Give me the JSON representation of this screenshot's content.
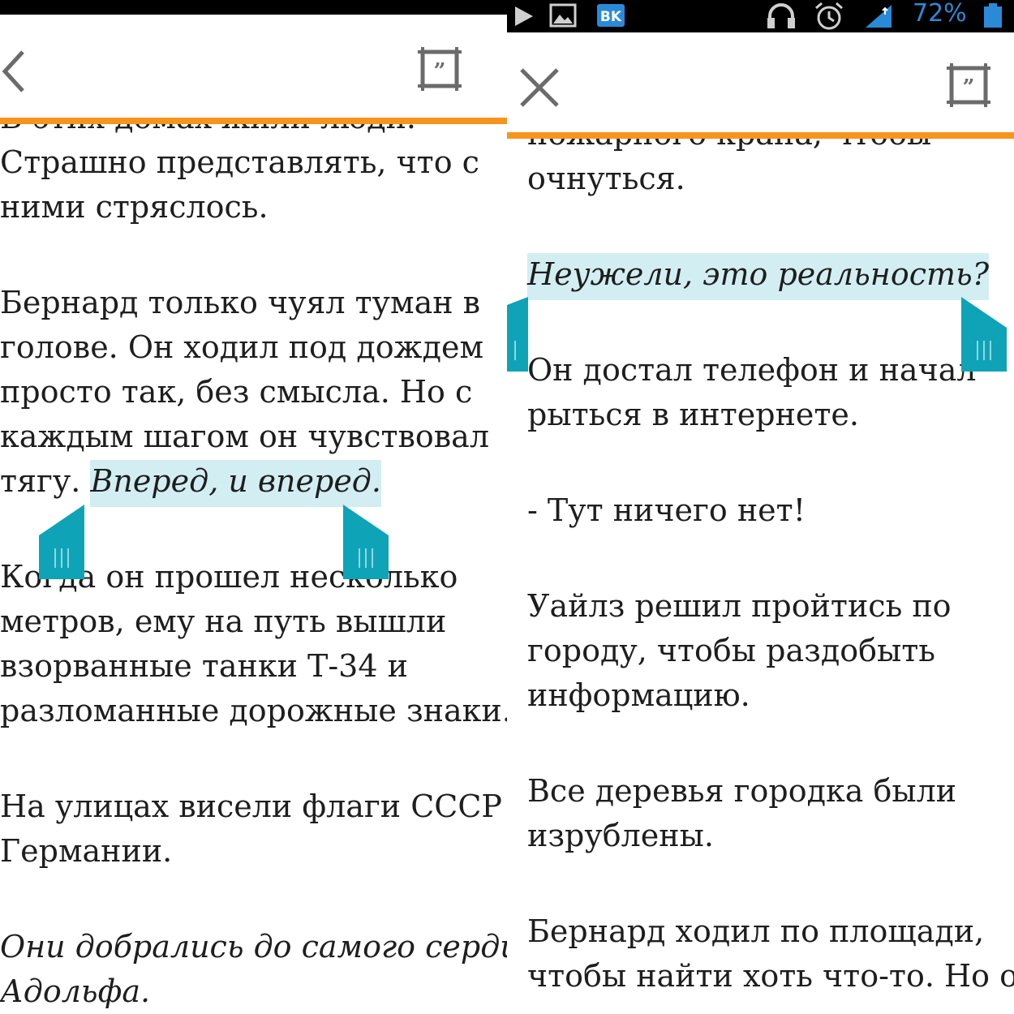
{
  "left": {
    "status_text": "",
    "overlap_line": "В этих домах жили люди.",
    "paragraphs": [
      {
        "lines": [
          "Страшно представлять, что с",
          "ними стряслось."
        ]
      },
      {
        "lines": [
          "Бернард только чуял туман в",
          "голове. Он ходил под дождем",
          "просто так, без смысла. Но с",
          "каждым шагом он чувствовал"
        ],
        "last_line_plain": "тягу. ",
        "last_line_selected": "Вперед, и вперед."
      },
      {
        "lines": [
          "Когда он прошел несколько",
          "метров, ему на путь вышли",
          "взорванные танки Т-34 и",
          "разломанные дорожные знаки."
        ]
      },
      {
        "lines": [
          "На улицах висели флаги СССР и",
          "Германии."
        ]
      },
      {
        "lines": [
          "Они добрались до самого сердца",
          "Адольфа."
        ]
      }
    ]
  },
  "right": {
    "status": {
      "battery_percent": "72%"
    },
    "overlap_line": "пожарного крана, чтобы",
    "paragraphs": [
      {
        "lines": [
          "очнуться."
        ]
      },
      {
        "selected": "Неужели, это реальность?"
      },
      {
        "lines": [
          "Он достал телефон и начал",
          "рыться в интернете."
        ]
      },
      {
        "lines": [
          "- Тут ничего нет!"
        ]
      },
      {
        "lines": [
          "Уайлз решил пройтись по",
          "городу, чтобы раздобыть",
          "информацию."
        ]
      },
      {
        "lines": [
          "Все деревья городка были",
          "изрублены."
        ]
      },
      {
        "lines": [
          "Бернард ходил по площади,",
          "чтобы найти хоть что-то. Но он"
        ]
      }
    ]
  },
  "colors": {
    "accent": "#f7941d",
    "selection": "#d2eef3",
    "handle": "#0fa3b8",
    "icon": "#666666"
  },
  "icons": [
    "back-arrow-icon",
    "close-icon",
    "quote-icon",
    "selection-handle-icon",
    "play-icon",
    "image-icon",
    "vk-icon",
    "headphones-icon",
    "alarm-icon",
    "signal-icon",
    "battery-icon"
  ]
}
